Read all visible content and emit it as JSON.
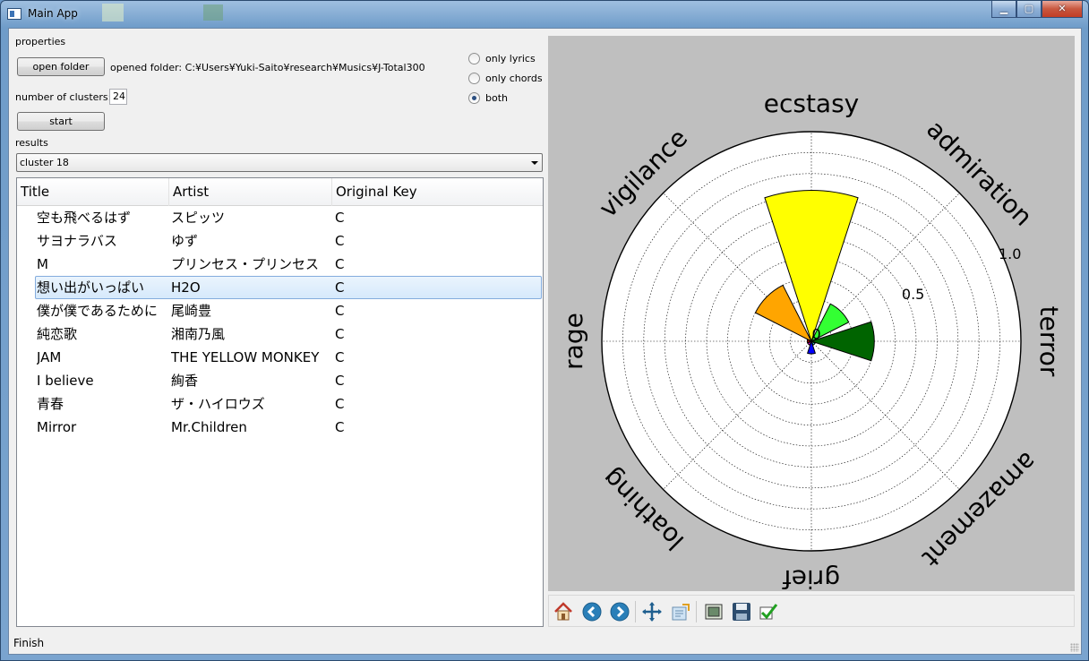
{
  "window": {
    "title": "Main App",
    "minimize": "▁",
    "maximize": "▢",
    "close": "✕"
  },
  "properties": {
    "heading": "properties",
    "open_folder_label": "open folder",
    "opened_folder_text": "opened folder: C:¥Users¥Yuki-Saito¥research¥Musics¥J-Total300",
    "num_clusters_label": "number of clusters:",
    "num_clusters_value": "24",
    "start_label": "start",
    "results_label": "results",
    "mode_options": [
      {
        "label": "only lyrics",
        "checked": false
      },
      {
        "label": "only chords",
        "checked": false
      },
      {
        "label": "both",
        "checked": true
      }
    ]
  },
  "results": {
    "selected_cluster": "cluster 18",
    "columns": [
      "Title",
      "Artist",
      "Original Key"
    ],
    "selected_row_index": 3,
    "rows": [
      {
        "title": "空も飛べるはず",
        "artist": "スピッツ",
        "key": "C"
      },
      {
        "title": "サヨナラバス",
        "artist": "ゆず",
        "key": "C"
      },
      {
        "title": "M",
        "artist": "プリンセス・プリンセス",
        "key": "C"
      },
      {
        "title": "想い出がいっぱい",
        "artist": "H2O",
        "key": "C"
      },
      {
        "title": "僕が僕であるために",
        "artist": "尾崎豊",
        "key": "C"
      },
      {
        "title": "純恋歌",
        "artist": "湘南乃風",
        "key": "C"
      },
      {
        "title": "JAM",
        "artist": "THE YELLOW MONKEY",
        "key": "C"
      },
      {
        "title": "I believe",
        "artist": "絢香",
        "key": "C"
      },
      {
        "title": "青春",
        "artist": "ザ・ハイロウズ",
        "key": "C"
      },
      {
        "title": "Mirror",
        "artist": "Mr.Children",
        "key": "C"
      }
    ]
  },
  "chart_data": {
    "type": "bar",
    "projection": "polar",
    "categories": [
      "ecstasy",
      "admiration",
      "terror",
      "amazement",
      "grief",
      "loathing",
      "rage",
      "vigilance"
    ],
    "values": [
      0.72,
      0.2,
      0.3,
      0.02,
      0.06,
      0.02,
      0.02,
      0.3
    ],
    "colors": [
      "#ffff00",
      "#33ff33",
      "#006400",
      "#40e0d0",
      "#0000ff",
      "#ff00ff",
      "#ff0000",
      "#ffa500"
    ],
    "radial_ticks": [
      "0",
      "0.5",
      "1.0"
    ],
    "rlim": [
      0,
      1.0
    ],
    "grid": true
  },
  "plot_toolbar": {
    "icons": [
      "home-icon",
      "back-icon",
      "forward-icon",
      "pan-icon",
      "configure-subplots-icon",
      "zoom-icon",
      "save-icon",
      "check-icon"
    ]
  },
  "status": {
    "text": "Finish"
  }
}
